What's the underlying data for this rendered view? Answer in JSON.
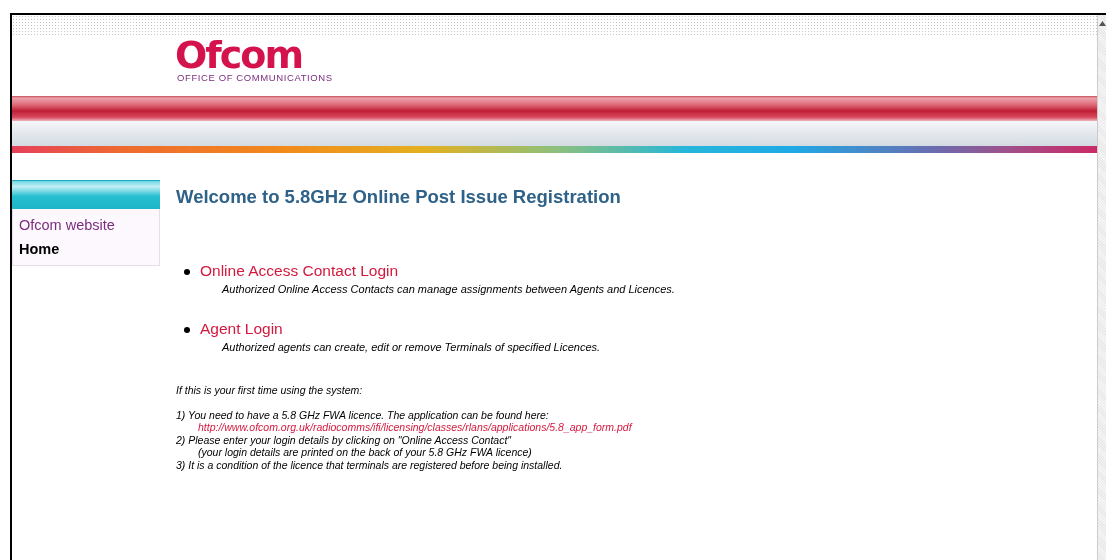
{
  "logo": {
    "wordmark": "Ofcom",
    "tagline": "OFFICE OF COMMUNICATIONS"
  },
  "sidebar": {
    "items": [
      {
        "label": "Ofcom website",
        "selected": false
      },
      {
        "label": "Home",
        "selected": true
      }
    ]
  },
  "heading": "Welcome to 5.8GHz Online Post Issue Registration",
  "logins": [
    {
      "link": "Online Access Contact Login",
      "description": "Authorized Online Access Contacts can manage assignments between Agents and Licences."
    },
    {
      "link": "Agent Login",
      "description": "Authorized agents can create, edit or remove Terminals of specified Licences."
    }
  ],
  "instructions": {
    "intro": "If this is your first time using the system:",
    "steps": [
      {
        "text": "1) You need to have a 5.8 GHz FWA licence. The application can be found here:",
        "link": "http://www.ofcom.org.uk/radiocomms/ifi/licensing/classes/rlans/applications/5.8_app_form.pdf"
      },
      {
        "text": "2) Please enter your login details by clicking on \"Online Access Contact\"",
        "note": "(your login details are printed on the back of your 5.8 GHz FWA licence)"
      },
      {
        "text": "3) It is a condition of the licence that terminals are registered before being installed."
      }
    ]
  }
}
